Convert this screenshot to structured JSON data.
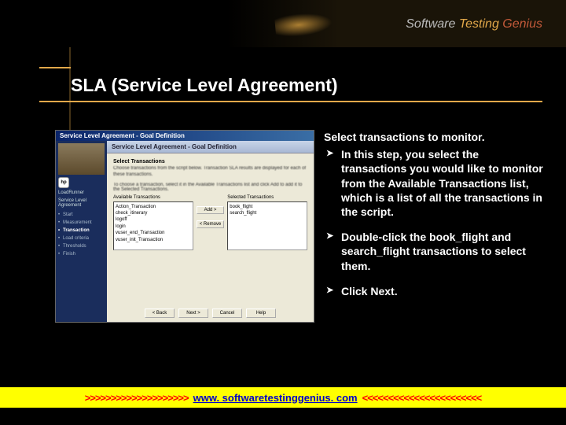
{
  "brand": {
    "w1": "Software",
    "w2": "Testing",
    "w3": "Genius"
  },
  "title": "SLA (Service Level Agreement)",
  "screenshot": {
    "window_title": "Service Level Agreement - Goal Definition",
    "panel_header": "Service Level Agreement - Goal Definition",
    "sidebar": {
      "product": "LoadRunner",
      "section": "Service Level Agreement",
      "items": [
        "Start",
        "Measurement",
        "Transaction",
        "Load criteria",
        "Thresholds",
        "Finish"
      ],
      "active_index": 2
    },
    "main": {
      "subheading": "Select Transactions",
      "desc": "Choose transactions from the script below. Transaction SLA results are displayed for each of these transactions.",
      "hint": "To choose a transaction, select it in the Available Transactions list and click Add to add it to the Selected Transactions.",
      "available_label": "Available Transactions",
      "selected_label": "Selected Transactions",
      "available_items": [
        "Action_Transaction",
        "check_itinerary",
        "logoff",
        "login",
        "vuser_end_Transaction",
        "vuser_init_Transaction"
      ],
      "selected_items": [
        "book_flight",
        "search_flight"
      ],
      "btn_add": "Add >",
      "btn_remove": "< Remove"
    },
    "footer_buttons": {
      "back": "< Back",
      "next": "Next >",
      "cancel": "Cancel",
      "help": "Help"
    }
  },
  "text": {
    "heading": "Select transactions to monitor.",
    "bullets": [
      "In this step, you select the transactions you would like to monitor from the Available Transactions list, which is a list of all the transactions in the script.",
      "Double-click the book_flight and search_flight transactions to select them.",
      "Click Next."
    ]
  },
  "footer": {
    "arrows_left": ">>>>>>>>>>>>>>>>>>>>",
    "link": "www. softwaretestinggenius. com",
    "arrows_right": "<<<<<<<<<<<<<<<<<<<<<<<"
  }
}
